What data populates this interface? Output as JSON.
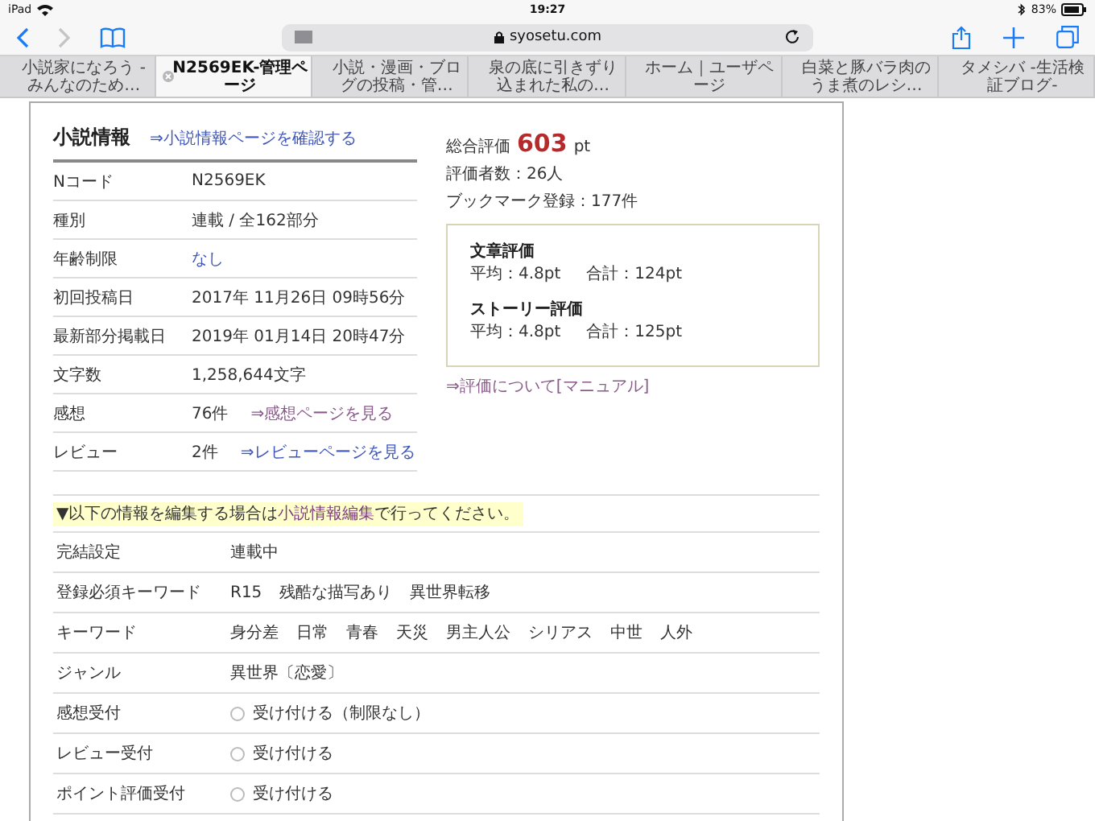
{
  "status_bar": {
    "device": "iPad",
    "time": "19:27",
    "battery": "83%"
  },
  "toolbar": {
    "url": "syosetu.com"
  },
  "tabs": [
    {
      "label": "小説家になろう - みんなのため…",
      "selected": false
    },
    {
      "label": "N2569EK-管理ページ",
      "selected": true
    },
    {
      "label": "小説・漫画・ブログの投稿・管…",
      "selected": false
    },
    {
      "label": "泉の底に引きずり込まれた私の…",
      "selected": false
    },
    {
      "label": "ホーム｜ユーザページ",
      "selected": false
    },
    {
      "label": "白菜と豚バラ肉のうま煮のレシ…",
      "selected": false
    },
    {
      "label": "タメシバ -生活検証ブログ-",
      "selected": false
    }
  ],
  "novel_info": {
    "heading": "小説情報",
    "heading_link": "⇒小説情報ページを確認する",
    "rows": [
      {
        "label": "Nコード",
        "value": "N2569EK",
        "kind": "text"
      },
      {
        "label": "種別",
        "value": "連載 / 全162部分",
        "kind": "text"
      },
      {
        "label": "年齢制限",
        "value": "なし",
        "kind": "link"
      },
      {
        "label": "初回投稿日",
        "value": "2017年 11月26日 09時56分",
        "kind": "text"
      },
      {
        "label": "最新部分掲載日",
        "value": "2019年 01月14日 20時47分",
        "kind": "text"
      },
      {
        "label": "文字数",
        "value": "1,258,644文字",
        "kind": "text"
      },
      {
        "label": "感想",
        "value": "76件",
        "kind": "text_link",
        "link": "⇒感想ページを見る"
      },
      {
        "label": "レビュー",
        "value": "2件",
        "kind": "text_link",
        "link": "⇒レビューページを見る"
      }
    ]
  },
  "rating": {
    "total_label": "総合評価",
    "total_value": "603",
    "total_unit": "pt",
    "raters": "評価者数：26人",
    "bookmarks": "ブックマーク登録：177件",
    "groups": [
      {
        "title": "文章評価",
        "average": "平均：4.8pt",
        "sum": "合計：124pt"
      },
      {
        "title": "ストーリー評価",
        "average": "平均：4.8pt",
        "sum": "合計：125pt"
      }
    ],
    "manual_link": "⇒評価について[マニュアル]"
  },
  "notice": {
    "before": "▼以下の情報を編集する場合は",
    "link": "小説情報編集",
    "after": "で行ってください。"
  },
  "settings": [
    {
      "label": "完結設定",
      "kind": "text",
      "values": [
        "連載中"
      ]
    },
    {
      "label": "登録必須キーワード",
      "kind": "tags",
      "values": [
        "R15",
        "残酷な描写あり",
        "異世界転移"
      ]
    },
    {
      "label": "キーワード",
      "kind": "tags",
      "values": [
        "身分差",
        "日常",
        "青春",
        "天災",
        "男主人公",
        "シリアス",
        "中世",
        "人外"
      ]
    },
    {
      "label": "ジャンル",
      "kind": "text",
      "values": [
        "異世界〔恋愛〕"
      ]
    },
    {
      "label": "感想受付",
      "kind": "radio",
      "values": [
        "受け付ける（制限なし）"
      ],
      "checked": false
    },
    {
      "label": "レビュー受付",
      "kind": "radio",
      "values": [
        "受け付ける"
      ],
      "checked": false
    },
    {
      "label": "ポイント評価受付",
      "kind": "radio",
      "values": [
        "受け付ける"
      ],
      "checked": false
    }
  ]
}
